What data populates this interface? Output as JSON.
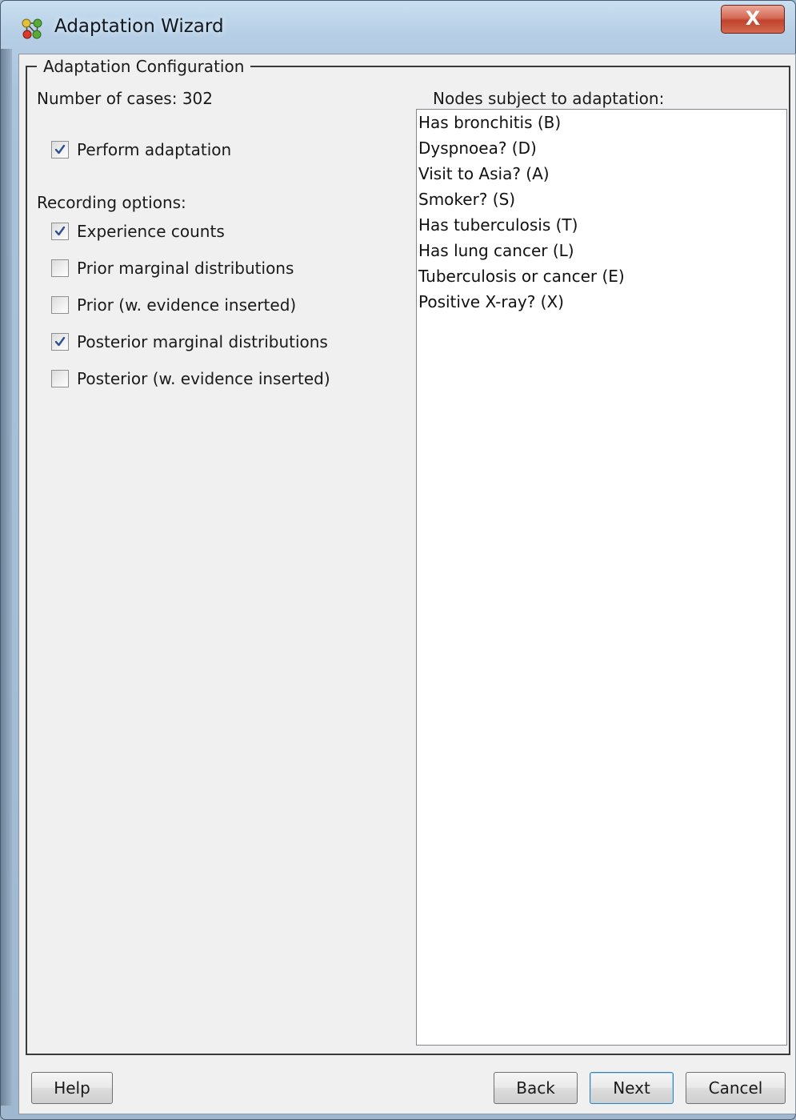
{
  "window": {
    "title": "Adaptation Wizard",
    "close_glyph": "X"
  },
  "group": {
    "legend": "Adaptation Configuration"
  },
  "left": {
    "num_cases_text": "Number of cases: 302",
    "perform_adaptation": {
      "label": "Perform adaptation",
      "checked": true
    },
    "recording_heading": "Recording options:",
    "options": [
      {
        "label": "Experience counts",
        "checked": true
      },
      {
        "label": "Prior marginal distributions",
        "checked": false
      },
      {
        "label": "Prior (w. evidence inserted)",
        "checked": false
      },
      {
        "label": "Posterior marginal distributions",
        "checked": true
      },
      {
        "label": "Posterior (w. evidence inserted)",
        "checked": false
      }
    ]
  },
  "right": {
    "heading": "Nodes subject to adaptation:",
    "nodes": [
      "Has bronchitis (B)",
      "Dyspnoea? (D)",
      "Visit to Asia? (A)",
      "Smoker? (S)",
      "Has tuberculosis (T)",
      "Has lung cancer (L)",
      "Tuberculosis or cancer (E)",
      "Positive X-ray? (X)"
    ]
  },
  "buttons": {
    "help": "Help",
    "back": "Back",
    "next": "Next",
    "cancel": "Cancel"
  },
  "colors": {
    "dialog_bg": "#f0f0f0",
    "check_mark": "#2b4f8f",
    "close_button": "#c9472f",
    "default_button_border": "#3c7fb1"
  }
}
